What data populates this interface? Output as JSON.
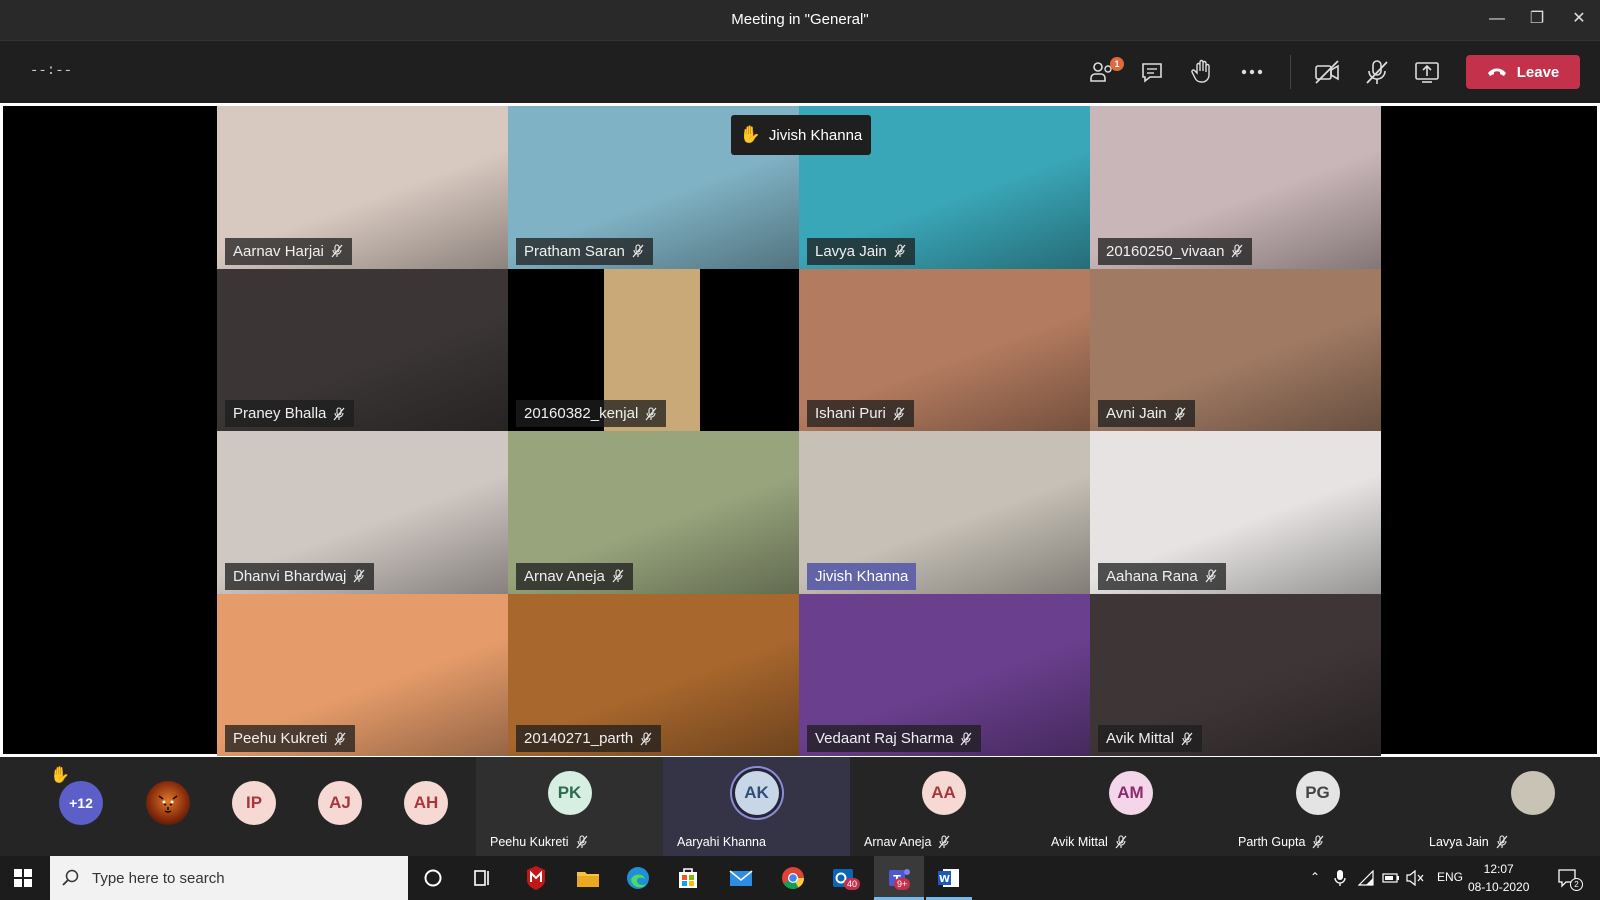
{
  "window": {
    "title": "Meeting in \"General\""
  },
  "toolbar": {
    "timer": "--:--",
    "participants_badge": "1",
    "leave_label": "Leave"
  },
  "toast": {
    "name": "Jivish Khanna"
  },
  "tiles": [
    {
      "name": "Aarnav Harjai",
      "bg": "#d8c9c0"
    },
    {
      "name": "Pratham Saran",
      "bg": "#7fb2c4"
    },
    {
      "name": "Lavya Jain",
      "bg": "#3aa7b8"
    },
    {
      "name": "20160250_vivaan",
      "bg": "#c9b6b8"
    },
    {
      "name": "Praney Bhalla",
      "bg": "#3b3635"
    },
    {
      "name": "20160382_kenjal",
      "bg": "#000000"
    },
    {
      "name": "Ishani Puri",
      "bg": "#b37b5f"
    },
    {
      "name": "Avni Jain",
      "bg": "#a07a63"
    },
    {
      "name": "Dhanvi Bhardwaj",
      "bg": "#cfc7c2"
    },
    {
      "name": "Arnav Aneja",
      "bg": "#97a47c"
    },
    {
      "name": "Jivish Khanna",
      "bg": "#c6c0b6",
      "active": true
    },
    {
      "name": "Aahana Rana",
      "bg": "#e6e3e2"
    },
    {
      "name": "Peehu Kukreti",
      "bg": "#e69c6a"
    },
    {
      "name": "20140271_parth",
      "bg": "#a8672d"
    },
    {
      "name": "Vedaant Raj Sharma",
      "bg": "#6a3f8e"
    },
    {
      "name": "Avik Mittal",
      "bg": "#3e3536"
    }
  ],
  "roster": {
    "overflow": "+12",
    "initials": [
      "IP",
      "AJ",
      "AH"
    ],
    "named": [
      {
        "initials": "PK",
        "name": "Peehu Kukreti"
      },
      {
        "initials": "AK",
        "name": "Aaryahi Khanna"
      },
      {
        "initials": "AA",
        "name": "Arnav Aneja"
      },
      {
        "initials": "AM",
        "name": "Avik Mittal"
      },
      {
        "initials": "PG",
        "name": "Parth Gupta"
      },
      {
        "initials": "",
        "name": "Lavya Jain"
      }
    ]
  },
  "taskbar": {
    "search_placeholder": "Type here to search",
    "outlook_badge": "40",
    "teams_badge": "9+",
    "lang": "ENG",
    "time": "12:07",
    "date": "08-10-2020",
    "notif_count": "2"
  },
  "colors": {
    "accent": "#6264a7",
    "leave": "#c4314b",
    "avatar_bg": "#f7d9d4",
    "avatar_fg": "#a6373f"
  }
}
